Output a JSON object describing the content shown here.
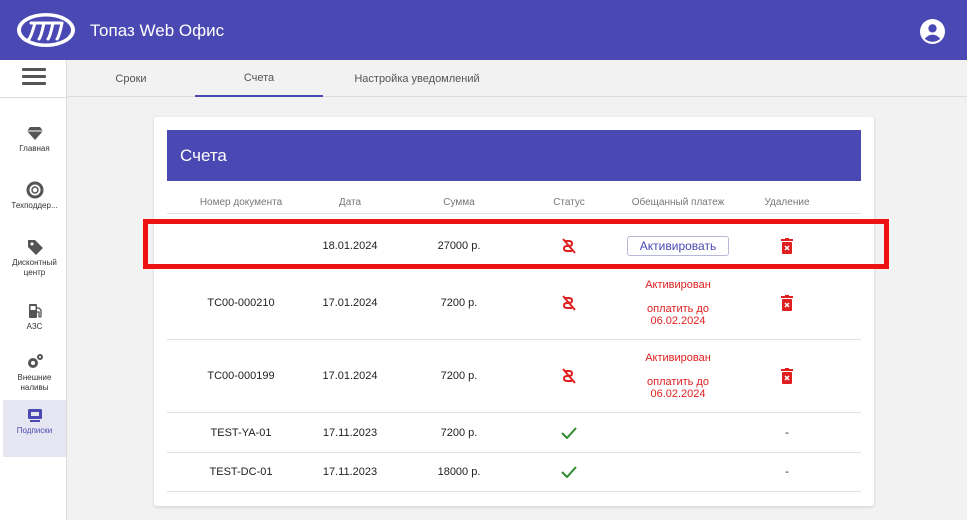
{
  "app": {
    "title": "Топаз Web Офис"
  },
  "sidebar": {
    "items": [
      {
        "label": "Главная",
        "icon": "diamond-icon"
      },
      {
        "label": "Техподдер...",
        "icon": "lifebuoy-icon"
      },
      {
        "label": "Дисконтный центр",
        "icon": "tag-icon"
      },
      {
        "label": "АЗС",
        "icon": "fuel-pump-icon"
      },
      {
        "label": "Внешние наливы",
        "icon": "gears-icon"
      },
      {
        "label": "Подписки",
        "icon": "subscriptions-icon"
      }
    ]
  },
  "tabs": [
    {
      "label": "Сроки"
    },
    {
      "label": "Счета"
    },
    {
      "label": "Настройка уведомлений"
    }
  ],
  "invoices": {
    "title": "Счета",
    "columns": [
      "Номер документа",
      "Дата",
      "Сумма",
      "Статус",
      "Обещанный платеж",
      "Удаление"
    ],
    "rows": [
      {
        "doc": "",
        "date": "18.01.2024",
        "sum": "27000 р.",
        "status": "unpaid",
        "promise_button": "Активировать",
        "delete": "trash"
      },
      {
        "doc": "TC00-000210",
        "date": "17.01.2024",
        "sum": "7200 р.",
        "status": "unpaid",
        "promise_status": "Активирован",
        "promise_due_line1": "оплатить до",
        "promise_due_line2": "06.02.2024",
        "delete": "trash"
      },
      {
        "doc": "TC00-000199",
        "date": "17.01.2024",
        "sum": "7200 р.",
        "status": "unpaid",
        "promise_status": "Активирован",
        "promise_due_line1": "оплатить до",
        "promise_due_line2": "06.02.2024",
        "delete": "trash"
      },
      {
        "doc": "TEST-YA-01",
        "date": "17.11.2023",
        "sum": "7200 р.",
        "status": "paid",
        "delete_text": "-"
      },
      {
        "doc": "TEST-DC-01",
        "date": "17.11.2023",
        "sum": "18000 р.",
        "status": "paid",
        "delete_text": "-"
      }
    ]
  },
  "colors": {
    "primary": "#4a48b3",
    "danger": "#e02020",
    "success": "#2e8b2e",
    "highlight": "#ee1111"
  }
}
